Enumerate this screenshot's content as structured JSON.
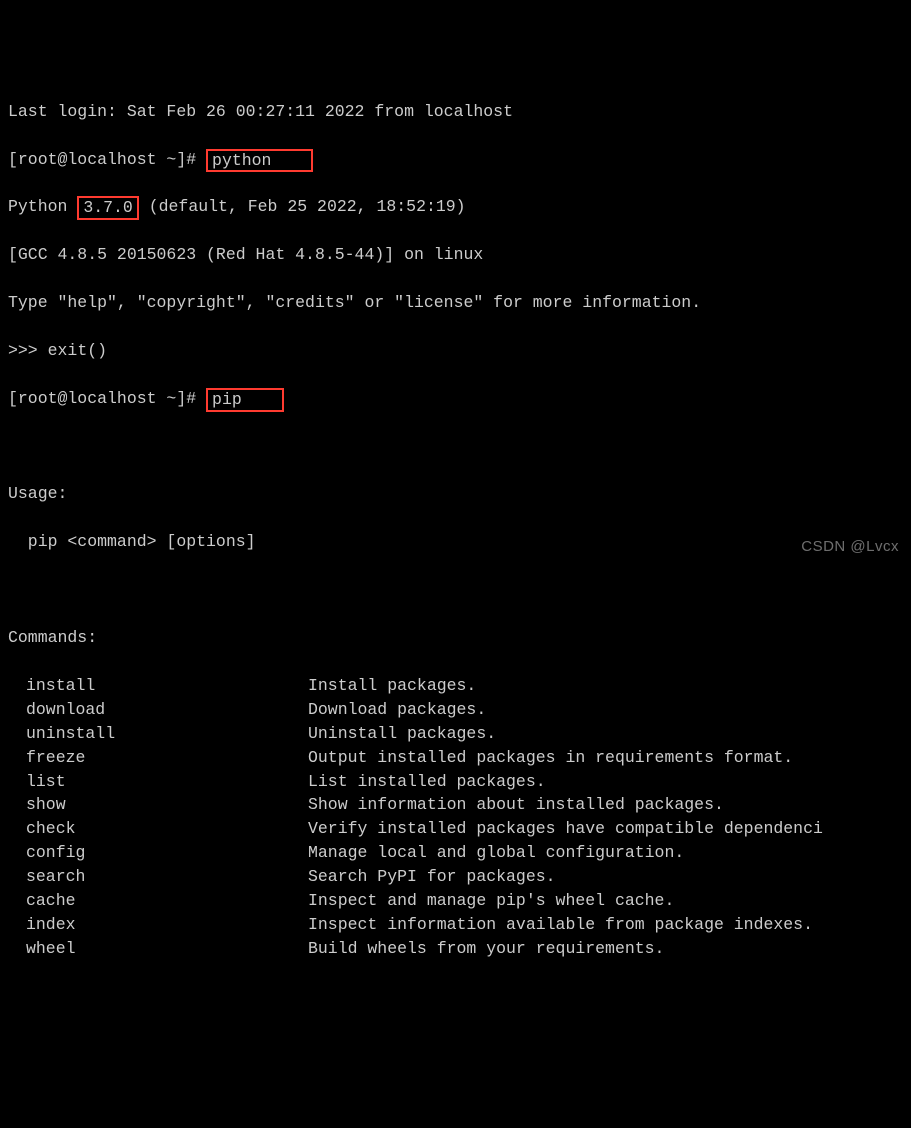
{
  "login_line": "Last login: Sat Feb 26 00:27:11 2022 from localhost",
  "prompt": "[root@localhost ~]# ",
  "cmd_python": "python",
  "py_version_prefix": "Python ",
  "py_version": "3.7.0",
  "py_version_suffix": " (default, Feb 25 2022, 18:52:19)",
  "gcc_line": "[GCC 4.8.5 20150623 (Red Hat 4.8.5-44)] on linux",
  "help_line": "Type \"help\", \"copyright\", \"credits\" or \"license\" for more information.",
  "py_prompt": ">>> ",
  "py_exit": "exit()",
  "cmd_pip": "pip",
  "usage_label": "Usage:",
  "usage_text": "  pip <command> [options]",
  "commands_label": "Commands:",
  "commands": [
    {
      "name": "install",
      "desc": "Install packages."
    },
    {
      "name": "download",
      "desc": "Download packages."
    },
    {
      "name": "uninstall",
      "desc": "Uninstall packages."
    },
    {
      "name": "freeze",
      "desc": "Output installed packages in requirements format."
    },
    {
      "name": "list",
      "desc": "List installed packages."
    },
    {
      "name": "show",
      "desc": "Show information about installed packages."
    },
    {
      "name": "check",
      "desc": "Verify installed packages have compatible dependenci"
    },
    {
      "name": "config",
      "desc": "Manage local and global configuration."
    },
    {
      "name": "search",
      "desc": "Search PyPI for packages."
    },
    {
      "name": "cache",
      "desc": "Inspect and manage pip's wheel cache."
    },
    {
      "name": "index",
      "desc": "Inspect information available from package indexes."
    },
    {
      "name": "wheel",
      "desc": "Build wheels from your requirements."
    }
  ],
  "watermark": "CSDN @Lvcx"
}
